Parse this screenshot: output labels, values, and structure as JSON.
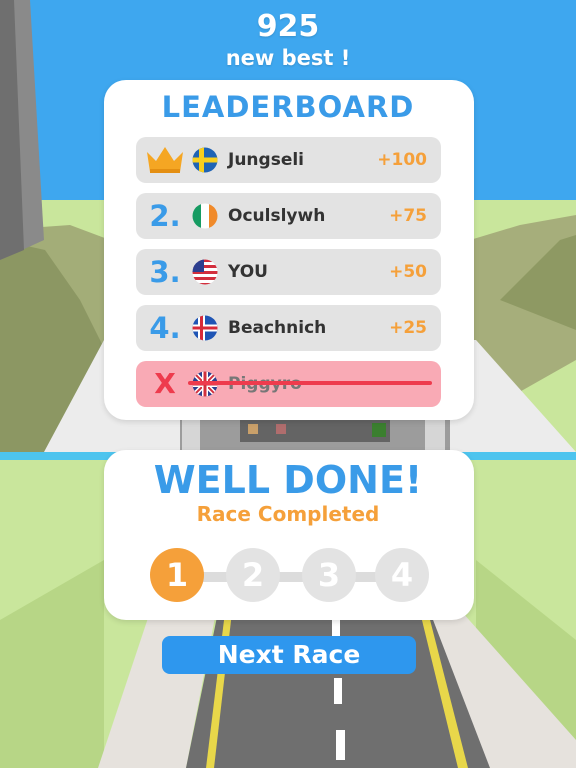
{
  "hud": {
    "score": "925",
    "best_label": "new best !"
  },
  "leaderboard": {
    "title": "LEADERBOARD",
    "rows": [
      {
        "rank": "",
        "icon": "crown-icon",
        "flag": "sweden-flag-icon",
        "name": "Jungseli",
        "points": "+100",
        "status": "first"
      },
      {
        "rank": "2.",
        "flag": "ireland-flag-icon",
        "name": "Oculslywh",
        "points": "+75",
        "status": "ranked"
      },
      {
        "rank": "3.",
        "flag": "usa-flag-icon",
        "name": "YOU",
        "points": "+50",
        "status": "ranked"
      },
      {
        "rank": "4.",
        "flag": "iceland-flag-icon",
        "name": "Beachnich",
        "points": "+25",
        "status": "ranked"
      },
      {
        "rank": "X",
        "flag": "uk-flag-icon",
        "name": "Piggyro",
        "points": "",
        "status": "eliminated"
      }
    ]
  },
  "result": {
    "title": "WELL DONE!",
    "subtitle": "Race Completed",
    "steps": [
      "1",
      "2",
      "3",
      "4"
    ],
    "current_step": 1
  },
  "next_button": {
    "label": "Next Race"
  },
  "colors": {
    "accent_blue": "#3a9be8",
    "accent_orange": "#f5a03a",
    "eliminated_red": "#ee3b4d",
    "button_blue": "#2e97ee"
  }
}
